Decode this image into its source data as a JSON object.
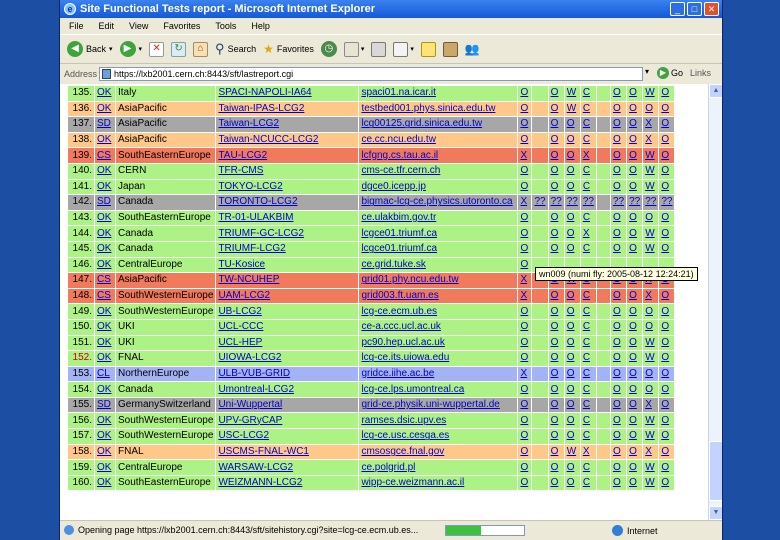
{
  "window": {
    "title": "Site Functional Tests report - Microsoft Internet Explorer"
  },
  "menu": [
    "File",
    "Edit",
    "View",
    "Favorites",
    "Tools",
    "Help"
  ],
  "toolbar": {
    "back": "Back",
    "search": "Search",
    "favorites": "Favorites"
  },
  "address": {
    "label": "Address",
    "url": "https://lxb2001.cern.ch:8443/sft/lastreport.cgi",
    "go": "Go",
    "links": "Links"
  },
  "tooltip": "wn009 (numi fly: 2005-08-12 12:24:21)",
  "status": {
    "text": "Opening page https://lxb2001.cern.ch:8443/sft/sitehistory.cgi?site=lcg-ce.ecm.ub.es...",
    "zone": "Internet",
    "progress": 0.45
  },
  "colors": {
    "green": "#adf285",
    "orange": "#ffc889",
    "red": "#f17a5c",
    "gray": "#a7a7a7",
    "blue": "#a3b3f5"
  },
  "rows": [
    {
      "num": "135.",
      "st": "OK",
      "region": "Italy",
      "site": "SPACI-NAPOLI-IA64",
      "host": "spaci01.na.icar.it",
      "r": [
        "O",
        "",
        "O",
        "W",
        "C",
        "",
        "O",
        "O",
        "W",
        "O"
      ],
      "bg": "g"
    },
    {
      "num": "136.",
      "st": "OK",
      "region": "AsiaPacific",
      "site": "Taiwan-IPAS-LCG2",
      "host": "testbed001.phys.sinica.edu.tw",
      "r": [
        "O",
        "",
        "O",
        "W",
        "C",
        "",
        "O",
        "O",
        "O",
        "O"
      ],
      "bg": "o"
    },
    {
      "num": "137.",
      "st": "SD",
      "region": "AsiaPacific",
      "site": "Taiwan-LCG2",
      "host": "lcg00125.grid.sinica.edu.tw",
      "r": [
        "O",
        "",
        "O",
        "O",
        "C",
        "",
        "O",
        "O",
        "X",
        "O"
      ],
      "bg": "gr"
    },
    {
      "num": "138.",
      "st": "OK",
      "region": "AsiaPacific",
      "site": "Taiwan-NCUCC-LCG2",
      "host": "ce.cc.ncu.edu.tw",
      "r": [
        "O",
        "",
        "O",
        "O",
        "C",
        "",
        "O",
        "O",
        "X",
        "O"
      ],
      "bg": "o"
    },
    {
      "num": "139.",
      "st": "CS",
      "region": "SouthEasternEurope",
      "site": "TAU-LCG2",
      "host": "lcfgng.cs.tau.ac.il",
      "r": [
        "X",
        "",
        "O",
        "O",
        "X",
        "",
        "O",
        "O",
        "W",
        "O"
      ],
      "bg": "r"
    },
    {
      "num": "140.",
      "st": "OK",
      "region": "CERN",
      "site": "TFR-CMS",
      "host": "cms-ce.tfr.cern.ch",
      "r": [
        "O",
        "",
        "O",
        "O",
        "C",
        "",
        "O",
        "O",
        "W",
        "O"
      ],
      "bg": "g"
    },
    {
      "num": "141.",
      "st": "OK",
      "region": "Japan",
      "site": "TOKYO-LCG2",
      "host": "dgce0.icepp.jp",
      "r": [
        "O",
        "",
        "O",
        "O",
        "C",
        "",
        "O",
        "O",
        "W",
        "O"
      ],
      "bg": "g"
    },
    {
      "num": "142.",
      "st": "SD",
      "region": "Canada",
      "site": "TORONTO-LCG2",
      "host": "bigmac-lcg-ce.physics.utoronto.ca",
      "r": [
        "X",
        "??",
        "??",
        "??",
        "??",
        "",
        "??",
        "??",
        "??",
        "??"
      ],
      "bg": "gr"
    },
    {
      "num": "143.",
      "st": "OK",
      "region": "SouthEasternEurope",
      "site": "TR-01-ULAKBIM",
      "host": "ce.ulakbim.gov.tr",
      "r": [
        "O",
        "",
        "O",
        "O",
        "C",
        "",
        "O",
        "O",
        "O",
        "O"
      ],
      "bg": "g"
    },
    {
      "num": "144.",
      "st": "OK",
      "region": "Canada",
      "site": "TRIUMF-GC-LCG2",
      "host": "lcgce01.triumf.ca",
      "r": [
        "O",
        "",
        "O",
        "O",
        "X",
        "",
        "O",
        "O",
        "W",
        "O"
      ],
      "bg": "g"
    },
    {
      "num": "145.",
      "st": "OK",
      "region": "Canada",
      "site": "TRIUMF-LCG2",
      "host": "lcgce01.triumf.ca",
      "r": [
        "O",
        "",
        "O",
        "O",
        "C",
        "",
        "O",
        "O",
        "W",
        "O"
      ],
      "bg": "g"
    },
    {
      "num": "146.",
      "st": "OK",
      "region": "CentralEurope",
      "site": "TU-Kosice",
      "host": "ce.grid.tuke.sk",
      "r": [
        "O",
        "",
        "",
        "",
        "",
        "",
        "",
        "",
        "",
        ""
      ],
      "bg": "g"
    },
    {
      "num": "147.",
      "st": "CS",
      "region": "AsiaPacific",
      "site": "TW-NCUHEP",
      "host": "grid01.phy.ncu.edu.tw",
      "r": [
        "X",
        "",
        "O",
        "W",
        "C",
        "",
        "O",
        "O",
        "X",
        "O"
      ],
      "bg": "r"
    },
    {
      "num": "148.",
      "st": "CS",
      "region": "SouthWesternEurope",
      "site": "UAM-LCG2",
      "host": "grid003.ft.uam.es",
      "r": [
        "X",
        "",
        "O",
        "O",
        "C",
        "",
        "O",
        "O",
        "X",
        "O"
      ],
      "bg": "r"
    },
    {
      "num": "149.",
      "st": "OK",
      "region": "SouthWesternEurope",
      "site": "UB-LCG2",
      "host": "lcg-ce.ecm.ub.es",
      "r": [
        "O",
        "",
        "O",
        "O",
        "C",
        "",
        "O",
        "O",
        "O",
        "O"
      ],
      "bg": "g"
    },
    {
      "num": "150.",
      "st": "OK",
      "region": "UKI",
      "site": "UCL-CCC",
      "host": "ce-a.ccc.ucl.ac.uk",
      "r": [
        "O",
        "",
        "O",
        "O",
        "C",
        "",
        "O",
        "O",
        "O",
        "O"
      ],
      "bg": "g"
    },
    {
      "num": "151.",
      "st": "OK",
      "region": "UKI",
      "site": "UCL-HEP",
      "host": "pc90.hep.ucl.ac.uk",
      "r": [
        "O",
        "",
        "O",
        "O",
        "C",
        "",
        "O",
        "O",
        "W",
        "O"
      ],
      "bg": "g"
    },
    {
      "num": "152.",
      "st": "OK",
      "region": "FNAL",
      "site": "UIOWA-LCG2",
      "host": "lcg-ce.its.uiowa.edu",
      "r": [
        "O",
        "",
        "O",
        "O",
        "C",
        "",
        "O",
        "O",
        "W",
        "O"
      ],
      "bg": "g",
      "numRed": true
    },
    {
      "num": "153.",
      "st": "CL",
      "region": "NorthernEurope",
      "site": "ULB-VUB-GRID",
      "host": "gridce.iihe.ac.be",
      "r": [
        "X",
        "",
        "O",
        "O",
        "C",
        "",
        "O",
        "O",
        "O",
        "O"
      ],
      "bg": "b"
    },
    {
      "num": "154.",
      "st": "OK",
      "region": "Canada",
      "site": "Umontreal-LCG2",
      "host": "lcg-ce.lps.umontreal.ca",
      "r": [
        "O",
        "",
        "O",
        "O",
        "C",
        "",
        "O",
        "O",
        "O",
        "O"
      ],
      "bg": "g"
    },
    {
      "num": "155.",
      "st": "SD",
      "region": "GermanySwitzerland",
      "site": "Uni-Wuppertal",
      "host": "grid-ce.physik.uni-wuppertal.de",
      "r": [
        "O",
        "",
        "O",
        "O",
        "C",
        "",
        "O",
        "O",
        "X",
        "O"
      ],
      "bg": "gr"
    },
    {
      "num": "156.",
      "st": "OK",
      "region": "SouthWesternEurope",
      "site": "UPV-GRyCAP",
      "host": "ramses.dsic.upv.es",
      "r": [
        "O",
        "",
        "O",
        "O",
        "C",
        "",
        "O",
        "O",
        "W",
        "O"
      ],
      "bg": "g"
    },
    {
      "num": "157.",
      "st": "OK",
      "region": "SouthWesternEurope",
      "site": "USC-LCG2",
      "host": "lcg-ce.usc.cesga.es",
      "r": [
        "O",
        "",
        "O",
        "O",
        "C",
        "",
        "O",
        "O",
        "W",
        "O"
      ],
      "bg": "g"
    },
    {
      "num": "158.",
      "st": "OK",
      "region": "FNAL",
      "site": "USCMS-FNAL-WC1",
      "host": "cmsosgce.fnal.gov",
      "r": [
        "O",
        "",
        "O",
        "W",
        "X",
        "",
        "O",
        "O",
        "X",
        "O"
      ],
      "bg": "o"
    },
    {
      "num": "159.",
      "st": "OK",
      "region": "CentralEurope",
      "site": "WARSAW-LCG2",
      "host": "ce.polgrid.pl",
      "r": [
        "O",
        "",
        "O",
        "O",
        "C",
        "",
        "O",
        "O",
        "W",
        "O"
      ],
      "bg": "g"
    },
    {
      "num": "160.",
      "st": "OK",
      "region": "SouthEasternEurope",
      "site": "WEIZMANN-LCG2",
      "host": "wipp-ce.weizmann.ac.il",
      "r": [
        "O",
        "",
        "O",
        "O",
        "C",
        "",
        "O",
        "O",
        "W",
        "O"
      ],
      "bg": "g"
    }
  ]
}
